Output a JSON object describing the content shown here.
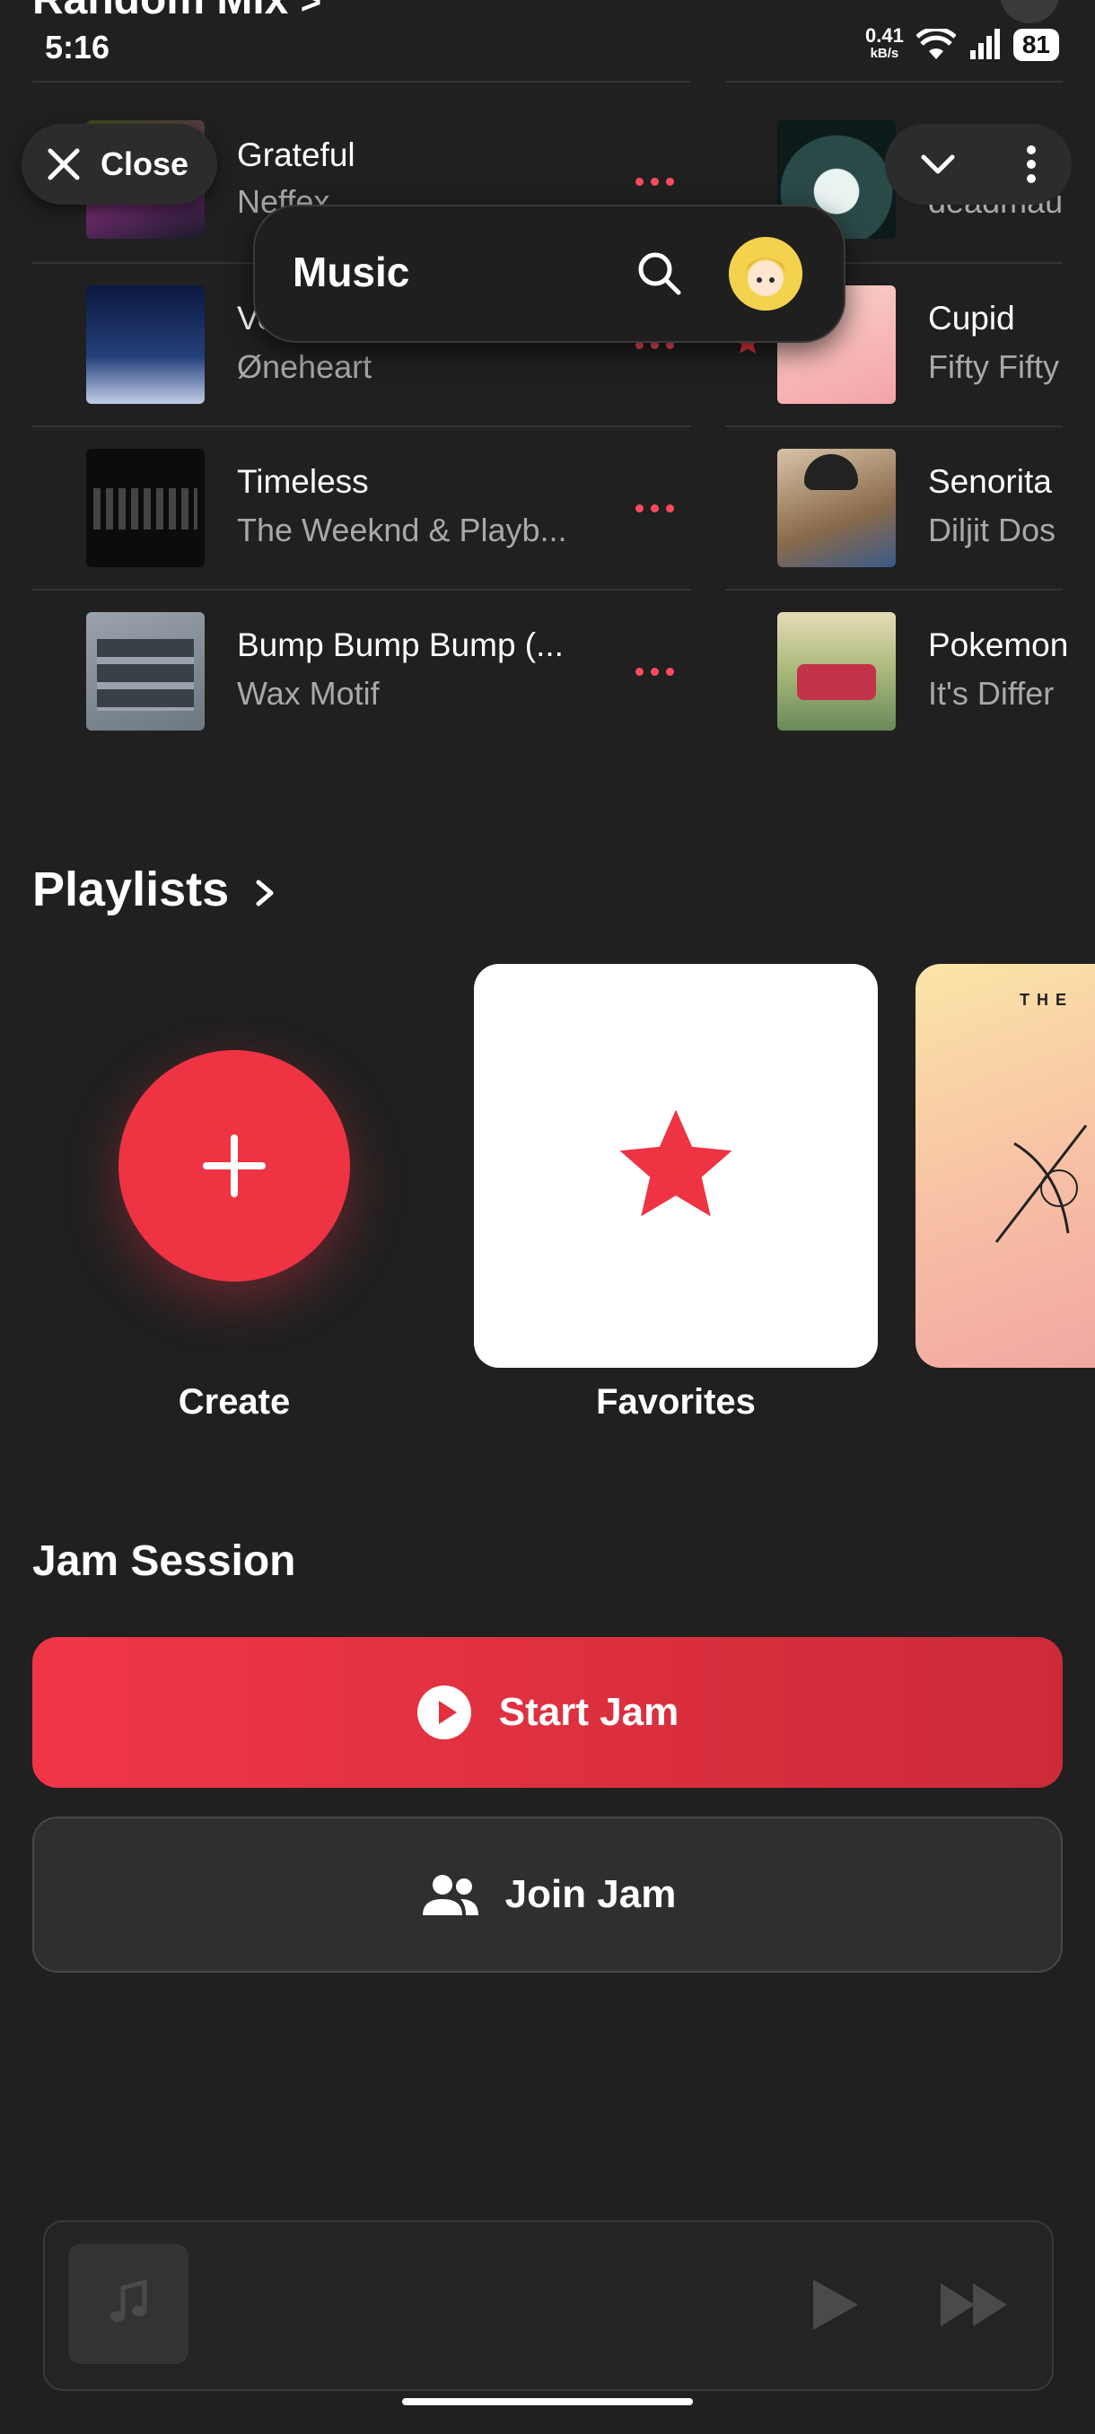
{
  "header": {
    "section_title": "Random Mix",
    "section_chevron": ">"
  },
  "status_bar": {
    "time": "5:16",
    "net_speed": "0.41",
    "net_unit": "kB/s",
    "battery": "81"
  },
  "close_pill": {
    "label": "Close"
  },
  "music_pill": {
    "label": "Music"
  },
  "tracks_left": [
    {
      "title": "Grateful",
      "artist": "Neffex"
    },
    {
      "title": "Vo",
      "artist": "Øneheart"
    },
    {
      "title": "Timeless",
      "artist": "The Weeknd & Playb..."
    },
    {
      "title": "Bump Bump Bump (...",
      "artist": "Wax Motif"
    }
  ],
  "tracks_right": [
    {
      "title": "",
      "artist": "deadmau"
    },
    {
      "title": "Cupid",
      "artist": "Fifty Fifty"
    },
    {
      "title": "Senorita",
      "artist": "Diljit Dos"
    },
    {
      "title": "Pokemon",
      "artist": "It's Differ"
    }
  ],
  "playlists": {
    "title": "Playlists",
    "items": [
      {
        "label": "Create"
      },
      {
        "label": "Favorites"
      }
    ],
    "cupid_card_text": "THE"
  },
  "jam": {
    "title": "Jam Session",
    "start_label": "Start Jam",
    "join_label": "Join Jam"
  },
  "colors": {
    "accent": "#ee3343",
    "background": "#202020"
  }
}
